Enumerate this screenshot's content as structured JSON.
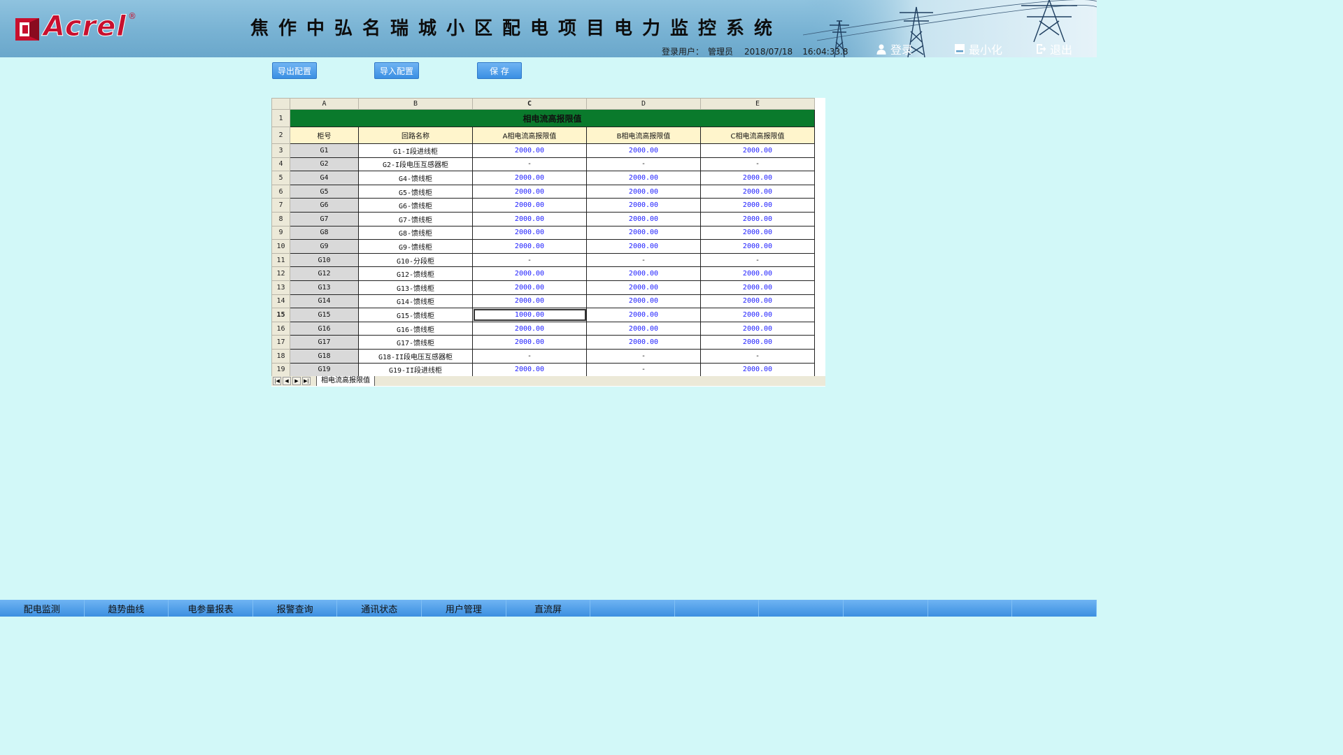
{
  "header": {
    "logo_text": "Acrel",
    "logo_reg": "®",
    "title": "焦作中弘名瑞城小区配电项目电力监控系统",
    "user_label": "登录用户：",
    "user_name": "管理员",
    "date": "2018/07/18",
    "time": "16:04:33.8",
    "login": "登录",
    "minimize": "最小化",
    "exit": "退出"
  },
  "toolbar": {
    "export": "导出配置",
    "import": "导入配置",
    "save": "保 存"
  },
  "sheet": {
    "col_letters": [
      "A",
      "B",
      "C",
      "D",
      "E"
    ],
    "title": "相电流高报限值",
    "headers": [
      "柜号",
      "回路名称",
      "A相电流高报限值",
      "B相电流高报限值",
      "C相电流高报限值"
    ],
    "rows": [
      {
        "n": "3",
        "id": "G1",
        "name": "G1-I段进线柜",
        "a": "2000.00",
        "b": "2000.00",
        "c": "2000.00"
      },
      {
        "n": "4",
        "id": "G2",
        "name": "G2-I段电压互感器柜",
        "a": "-",
        "b": "-",
        "c": "-"
      },
      {
        "n": "5",
        "id": "G4",
        "name": "G4-馈线柜",
        "a": "2000.00",
        "b": "2000.00",
        "c": "2000.00"
      },
      {
        "n": "6",
        "id": "G5",
        "name": "G5-馈线柜",
        "a": "2000.00",
        "b": "2000.00",
        "c": "2000.00"
      },
      {
        "n": "7",
        "id": "G6",
        "name": "G6-馈线柜",
        "a": "2000.00",
        "b": "2000.00",
        "c": "2000.00"
      },
      {
        "n": "8",
        "id": "G7",
        "name": "G7-馈线柜",
        "a": "2000.00",
        "b": "2000.00",
        "c": "2000.00"
      },
      {
        "n": "9",
        "id": "G8",
        "name": "G8-馈线柜",
        "a": "2000.00",
        "b": "2000.00",
        "c": "2000.00"
      },
      {
        "n": "10",
        "id": "G9",
        "name": "G9-馈线柜",
        "a": "2000.00",
        "b": "2000.00",
        "c": "2000.00"
      },
      {
        "n": "11",
        "id": "G10",
        "name": "G10-分段柜",
        "a": "-",
        "b": "-",
        "c": "-"
      },
      {
        "n": "12",
        "id": "G12",
        "name": "G12-馈线柜",
        "a": "2000.00",
        "b": "2000.00",
        "c": "2000.00"
      },
      {
        "n": "13",
        "id": "G13",
        "name": "G13-馈线柜",
        "a": "2000.00",
        "b": "2000.00",
        "c": "2000.00"
      },
      {
        "n": "14",
        "id": "G14",
        "name": "G14-馈线柜",
        "a": "2000.00",
        "b": "2000.00",
        "c": "2000.00"
      },
      {
        "n": "15",
        "id": "G15",
        "name": "G15-馈线柜",
        "a": "1000.00",
        "b": "2000.00",
        "c": "2000.00"
      },
      {
        "n": "16",
        "id": "G16",
        "name": "G16-馈线柜",
        "a": "2000.00",
        "b": "2000.00",
        "c": "2000.00"
      },
      {
        "n": "17",
        "id": "G17",
        "name": "G17-馈线柜",
        "a": "2000.00",
        "b": "2000.00",
        "c": "2000.00"
      },
      {
        "n": "18",
        "id": "G18",
        "name": "G18-II段电压互感器柜",
        "a": "-",
        "b": "-",
        "c": "-"
      },
      {
        "n": "19",
        "id": "G19",
        "name": "G19-II段进线柜",
        "a": "2000.00",
        "b": "-",
        "c": "2000.00"
      }
    ],
    "active_row": "15",
    "tab_name": "相电流高报限值"
  },
  "nav": [
    "配电监测",
    "趋势曲线",
    "电参量报表",
    "报警查询",
    "通讯状态",
    "用户管理",
    "直流屏",
    "",
    "",
    "",
    "",
    "",
    ""
  ],
  "colors": {
    "title_bar_green": "#0a7a2c",
    "value_blue": "#1a1aff",
    "background": "#d2f8f8",
    "nav_blue": "#3c8fe0",
    "logo_red": "#c8102e"
  }
}
